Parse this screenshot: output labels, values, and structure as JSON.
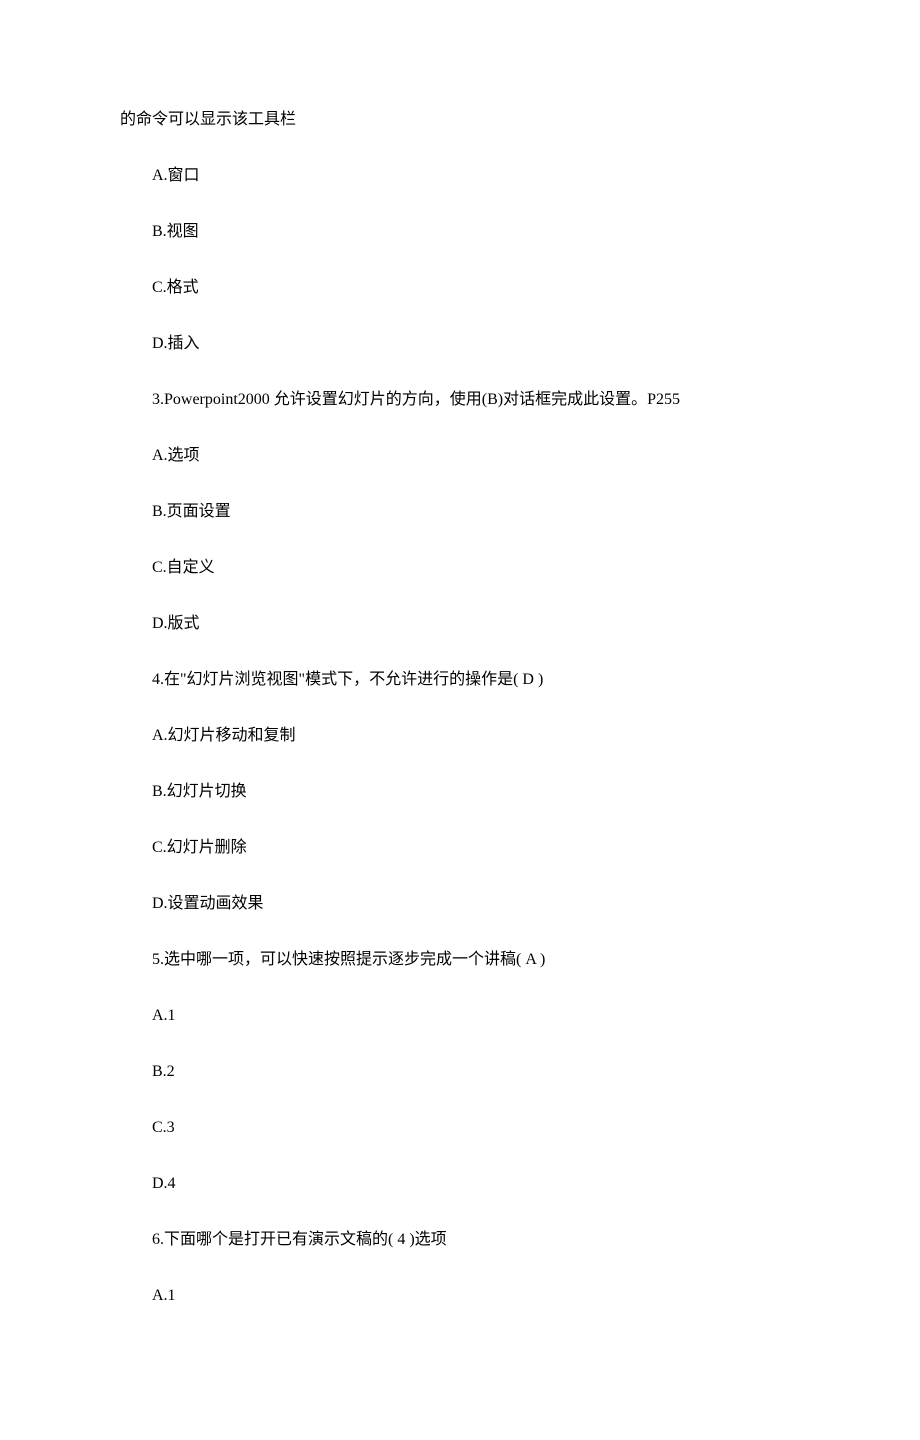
{
  "lines": [
    {
      "text": "的命令可以显示该工具栏",
      "indent": false
    },
    {
      "text": "A.窗口",
      "indent": true
    },
    {
      "text": "B.视图",
      "indent": true
    },
    {
      "text": "C.格式",
      "indent": true
    },
    {
      "text": "D.插入",
      "indent": true
    },
    {
      "text": "3.Powerpoint2000 允许设置幻灯片的方向，使用(B)对话框完成此设置。P255",
      "indent": true
    },
    {
      "text": "A.选项",
      "indent": true
    },
    {
      "text": "B.页面设置",
      "indent": true
    },
    {
      "text": "C.自定义",
      "indent": true
    },
    {
      "text": "D.版式",
      "indent": true
    },
    {
      "text": "4.在\"幻灯片浏览视图\"模式下，不允许进行的操作是( D )",
      "indent": true
    },
    {
      "text": "A.幻灯片移动和复制",
      "indent": true
    },
    {
      "text": "B.幻灯片切换",
      "indent": true
    },
    {
      "text": "C.幻灯片删除",
      "indent": true
    },
    {
      "text": "D.设置动画效果",
      "indent": true
    },
    {
      "text": "5.选中哪一项，可以快速按照提示逐步完成一个讲稿( A )",
      "indent": true
    },
    {
      "text": "A.1",
      "indent": true
    },
    {
      "text": "B.2",
      "indent": true
    },
    {
      "text": "C.3",
      "indent": true
    },
    {
      "text": "D.4",
      "indent": true
    },
    {
      "text": "6.下面哪个是打开已有演示文稿的( 4 )选项",
      "indent": true
    },
    {
      "text": "A.1",
      "indent": true
    }
  ]
}
